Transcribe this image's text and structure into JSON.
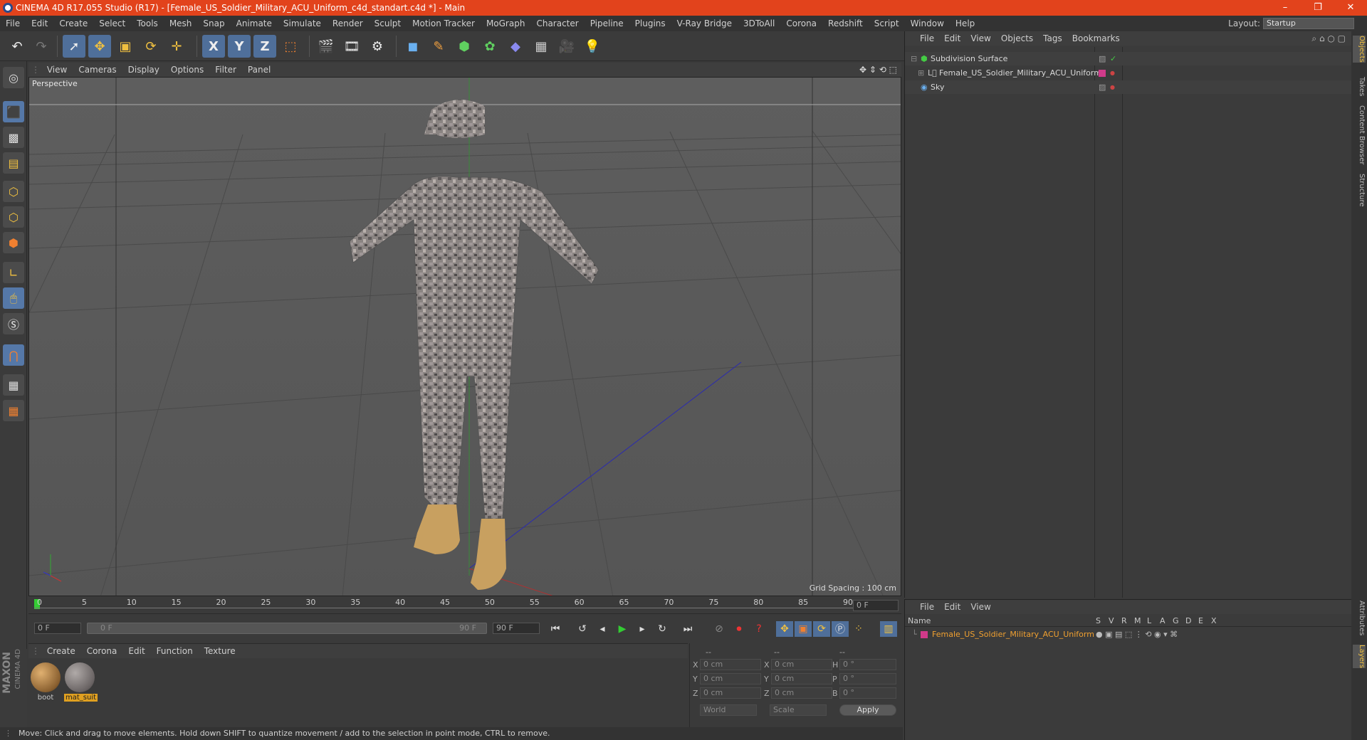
{
  "window": {
    "title": "CINEMA 4D R17.055 Studio (R17) - [Female_US_Soldier_Military_ACU_Uniform_c4d_standart.c4d *] - Main",
    "minimize": "–",
    "restore": "❐",
    "close": "✕"
  },
  "menubar": {
    "items": [
      "File",
      "Edit",
      "Create",
      "Select",
      "Tools",
      "Mesh",
      "Snap",
      "Animate",
      "Simulate",
      "Render",
      "Sculpt",
      "Motion Tracker",
      "MoGraph",
      "Character",
      "Pipeline",
      "Plugins",
      "V-Ray Bridge",
      "3DToAll",
      "Corona",
      "Redshift",
      "Script",
      "Window",
      "Help"
    ],
    "layout_label": "Layout:",
    "layout_value": "Startup"
  },
  "toolbar": {
    "axis_x": "X",
    "axis_y": "Y",
    "axis_z": "Z"
  },
  "viewport": {
    "menu": [
      "View",
      "Cameras",
      "Display",
      "Options",
      "Filter",
      "Panel"
    ],
    "label": "Perspective",
    "grid_spacing": "Grid Spacing : 100 cm"
  },
  "timeline": {
    "ticks": [
      "0",
      "5",
      "10",
      "15",
      "20",
      "25",
      "30",
      "35",
      "40",
      "45",
      "50",
      "55",
      "60",
      "65",
      "70",
      "75",
      "80",
      "85",
      "90"
    ],
    "current_frame": "0 F",
    "start_field": "0 F",
    "range_start": "0 F",
    "range_end": "90 F",
    "end_field": "90 F"
  },
  "materials": {
    "menu": [
      "Create",
      "Corona",
      "Edit",
      "Function",
      "Texture"
    ],
    "items": [
      {
        "name": "boot"
      },
      {
        "name": "mat_suit"
      }
    ]
  },
  "coords": {
    "headers": [
      "--",
      "--",
      "--"
    ],
    "rows": [
      {
        "l1": "X",
        "v1": "0 cm",
        "l2": "X",
        "v2": "0 cm",
        "l3": "H",
        "v3": "0 °"
      },
      {
        "l1": "Y",
        "v1": "0 cm",
        "l2": "Y",
        "v2": "0 cm",
        "l3": "P",
        "v3": "0 °"
      },
      {
        "l1": "Z",
        "v1": "0 cm",
        "l2": "Z",
        "v2": "0 cm",
        "l3": "B",
        "v3": "0 °"
      }
    ],
    "world": "World",
    "scale": "Scale",
    "apply": "Apply"
  },
  "objects": {
    "menu": [
      "File",
      "Edit",
      "View",
      "Objects",
      "Tags",
      "Bookmarks"
    ],
    "items": [
      {
        "name": "Subdivision Surface"
      },
      {
        "name": "Female_US_Soldier_Military_ACU_Uniform"
      },
      {
        "name": "Sky"
      }
    ]
  },
  "layers": {
    "menu": [
      "File",
      "Edit",
      "View"
    ],
    "col_name": "Name",
    "cols": [
      "S",
      "V",
      "R",
      "M",
      "L",
      "A",
      "G",
      "D",
      "E",
      "X"
    ],
    "item": "Female_US_Soldier_Military_ACU_Uniform"
  },
  "right_tabs": [
    "Objects",
    "Takes",
    "Content Browser",
    "Structure",
    "Attributes",
    "Layers"
  ],
  "status": "Move: Click and drag to move elements. Hold down SHIFT to quantize movement / add to the selection in point mode, CTRL to remove.",
  "branding": {
    "maxon": "MAXON",
    "product": "CINEMA 4D"
  },
  "colors": {
    "accent": "#e2431c",
    "selection": "#4f6f9a",
    "layer_color": "#d03a8a"
  }
}
